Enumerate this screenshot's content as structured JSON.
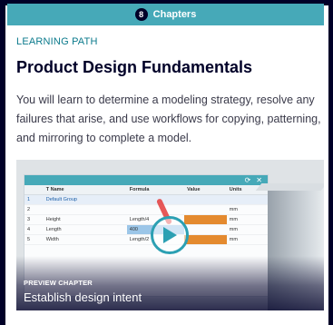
{
  "header": {
    "chapter_count": "8",
    "chapters_label": "Chapters"
  },
  "course": {
    "eyebrow": "LEARNING PATH",
    "title": "Product Design Fundamentals",
    "description": "You will learn to determine a modeling strategy, resolve any failures that arise, and use workflows for copying, patterning, and mirroring to complete a model."
  },
  "preview": {
    "eyebrow": "PREVIEW CHAPTER",
    "title": "Establish design intent",
    "play_icon": "play-icon",
    "screenshot": {
      "titlebar_icons": [
        "refresh-icon",
        "close-icon"
      ],
      "columns": [
        "",
        "T  Name",
        "Formula",
        "Value",
        "Units"
      ],
      "rows": [
        {
          "num": "1",
          "name": "Default Group",
          "formula": "",
          "value": "",
          "units": "",
          "style": "group"
        },
        {
          "num": "2",
          "name": "",
          "formula": "",
          "value": "",
          "units": "mm",
          "style": ""
        },
        {
          "num": "3",
          "name": "Height",
          "formula": "Length/4",
          "value": "",
          "units": "mm",
          "style": "orange"
        },
        {
          "num": "4",
          "name": "Length",
          "formula": "400",
          "value": "",
          "units": "mm",
          "style": "blue"
        },
        {
          "num": "5",
          "name": "Width",
          "formula": "Length/2",
          "value": "",
          "units": "mm",
          "style": "orange"
        }
      ]
    }
  },
  "colors": {
    "page_bg": "#000028",
    "accent": "#46a9b8",
    "eyebrow": "#0b7a8c"
  }
}
